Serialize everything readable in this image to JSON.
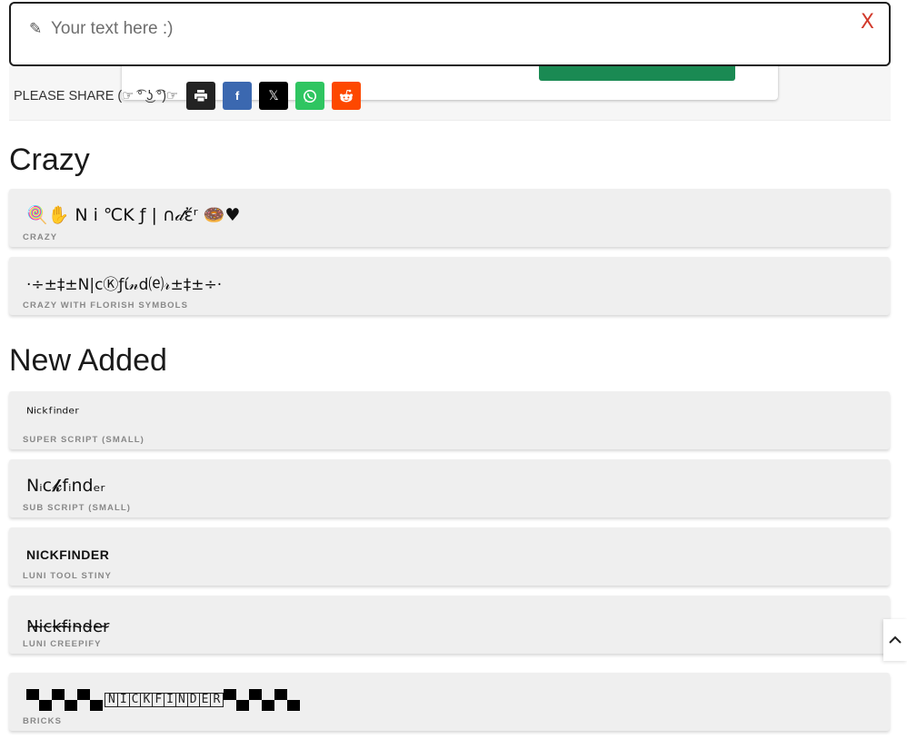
{
  "input": {
    "placeholder": "Your text here :)",
    "value": "",
    "pencil_icon": "✎",
    "close_label": "X"
  },
  "share": {
    "label": "PLEASE SHARE (☞ ͡° ͜ʖ ͡°)☞",
    "buttons": [
      {
        "name": "print",
        "icon": "printer-icon",
        "color": "#232323"
      },
      {
        "name": "facebook",
        "icon": "facebook-icon",
        "color": "#3b68b0",
        "glyph": "f"
      },
      {
        "name": "x",
        "icon": "x-icon",
        "color": "#000000",
        "glyph": "𝕏"
      },
      {
        "name": "whatsapp",
        "icon": "whatsapp-icon",
        "color": "#2fc561"
      },
      {
        "name": "reddit",
        "icon": "reddit-icon",
        "color": "#fd4800"
      }
    ]
  },
  "sections": {
    "crazy": {
      "title": "Crazy",
      "items": [
        {
          "nick": "🍭✋ N i ℃K ƒ | ∩𝒹ἔʳ 🍩♥",
          "label": "CRAZY"
        },
        {
          "nick": "·÷±‡±N|cⓀƒί𝓃d⒠𝓇±‡±÷·",
          "label": "CRAZY WITH FLORISH SYMBOLS"
        }
      ]
    },
    "new_added": {
      "title": "New Added",
      "items": [
        {
          "nick": "ᴺⁱᶜᵏᶠⁱⁿᵈᵉʳ",
          "label": "SUPER SCRIPT (SMALL)"
        },
        {
          "nick": "Nᵢc𝓴fᵢndₑᵣ",
          "label": "SUB SCRIPT (SMALL)"
        },
        {
          "nick": "NICKFINDER",
          "label": "LUNI TOOL STINY"
        },
        {
          "nick": "N̴i̴c̴k̴f̴i̴n̴d̴e̴r̴",
          "label": "LUNI CREEPIFY"
        },
        {
          "nick": "NICKFINDER",
          "label": "BRICKS"
        }
      ]
    }
  }
}
